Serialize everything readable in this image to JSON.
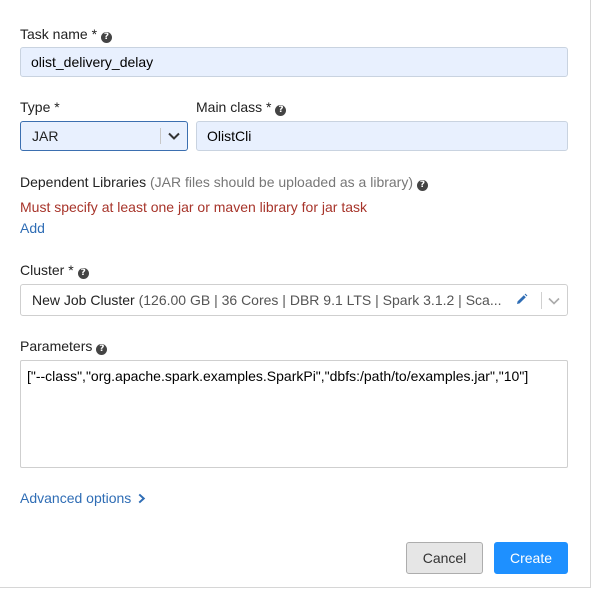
{
  "task_name": {
    "label": "Task name *",
    "value": "olist_delivery_delay"
  },
  "type": {
    "label": "Type *",
    "selected": "JAR"
  },
  "main_class": {
    "label": "Main class *",
    "value": "OlistCli"
  },
  "dependent_libraries": {
    "label": "Dependent Libraries",
    "hint": "(JAR files should be uploaded as a library)",
    "error": "Must specify at least one jar or maven library for jar task",
    "add_label": "Add"
  },
  "cluster": {
    "label": "Cluster *",
    "name": "New Job Cluster",
    "details": "(126.00 GB | 36 Cores | DBR 9.1 LTS | Spark 3.1.2 | Sca..."
  },
  "parameters": {
    "label": "Parameters",
    "value": "[\"--class\",\"org.apache.spark.examples.SparkPi\",\"dbfs:/path/to/examples.jar\",\"10\"]"
  },
  "advanced_options_label": "Advanced options",
  "buttons": {
    "cancel": "Cancel",
    "create": "Create"
  },
  "colors": {
    "link": "#2f6db5",
    "error": "#a7342a",
    "primary": "#1e90ff",
    "input_fill": "#e8f0fe"
  }
}
